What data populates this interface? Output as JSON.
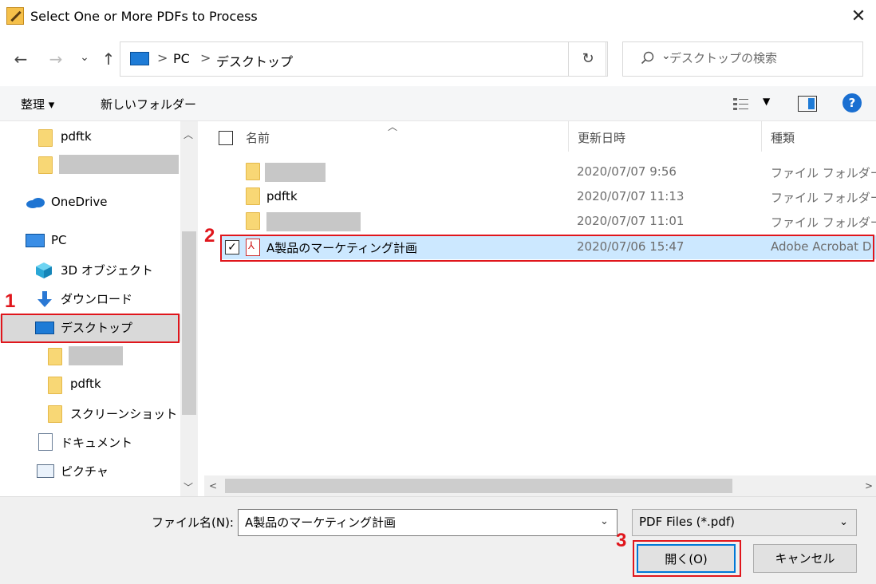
{
  "window": {
    "title": "Select One or More PDFs to Process",
    "close_glyph": "✕"
  },
  "nav_buttons": {
    "back": "←",
    "forward": "→",
    "recent": "⌄",
    "up": "↑",
    "refresh": "↻"
  },
  "address": {
    "crumbs": [
      "PC",
      "デスクトップ"
    ],
    "separator": ">",
    "dropdown": "⌄"
  },
  "search": {
    "placeholder": "デスクトップの検索"
  },
  "toolbar": {
    "organize": "整理 ▾",
    "new_folder": "新しいフォルダー",
    "help": "?"
  },
  "nav": {
    "items": [
      {
        "label": "pdftk",
        "icon": "folder-icon"
      },
      {
        "label": "",
        "icon": "folder-icon",
        "redacted": true
      },
      {
        "label": "OneDrive",
        "icon": "cloud-icon"
      },
      {
        "label": "PC",
        "icon": "pc-icon"
      },
      {
        "label": "3D オブジェクト",
        "icon": "cube-icon"
      },
      {
        "label": "ダウンロード",
        "icon": "download-icon"
      },
      {
        "label": "デスクトップ",
        "icon": "desktop-icon",
        "selected": true
      },
      {
        "label": "",
        "icon": "folder-icon",
        "redacted": true
      },
      {
        "label": "pdftk",
        "icon": "folder-icon"
      },
      {
        "label": "スクリーンショット",
        "icon": "folder-icon"
      },
      {
        "label": "ドキュメント",
        "icon": "document-icon"
      },
      {
        "label": "ピクチャ",
        "icon": "picture-icon"
      }
    ]
  },
  "list": {
    "columns": {
      "name": "名前",
      "modified": "更新日時",
      "type": "種類"
    },
    "rows": [
      {
        "name": "",
        "redacted": true,
        "modified": "2020/07/07 9:56",
        "type": "ファイル フォルダー"
      },
      {
        "name": "pdftk",
        "modified": "2020/07/07 11:13",
        "type": "ファイル フォルダー"
      },
      {
        "name": "",
        "redacted": true,
        "modified": "2020/07/07 11:01",
        "type": "ファイル フォルダー"
      },
      {
        "name": "A製品のマーケティング計画",
        "modified": "2020/07/06 15:47",
        "type": "Adobe Acrobat D",
        "selected": true,
        "checkbox": "✓"
      }
    ]
  },
  "bottom": {
    "filename_label": "ファイル名(N):",
    "filename_value": "A製品のマーケティング計画",
    "filter_value": "PDF Files (*.pdf)",
    "open_label": "開く(O)",
    "cancel_label": "キャンセル",
    "dd": "⌄"
  },
  "annotations": [
    "1",
    "2",
    "3"
  ],
  "colors": {
    "accent": "#0078d7",
    "selection": "#cce8ff",
    "annotation": "#e0161c"
  }
}
